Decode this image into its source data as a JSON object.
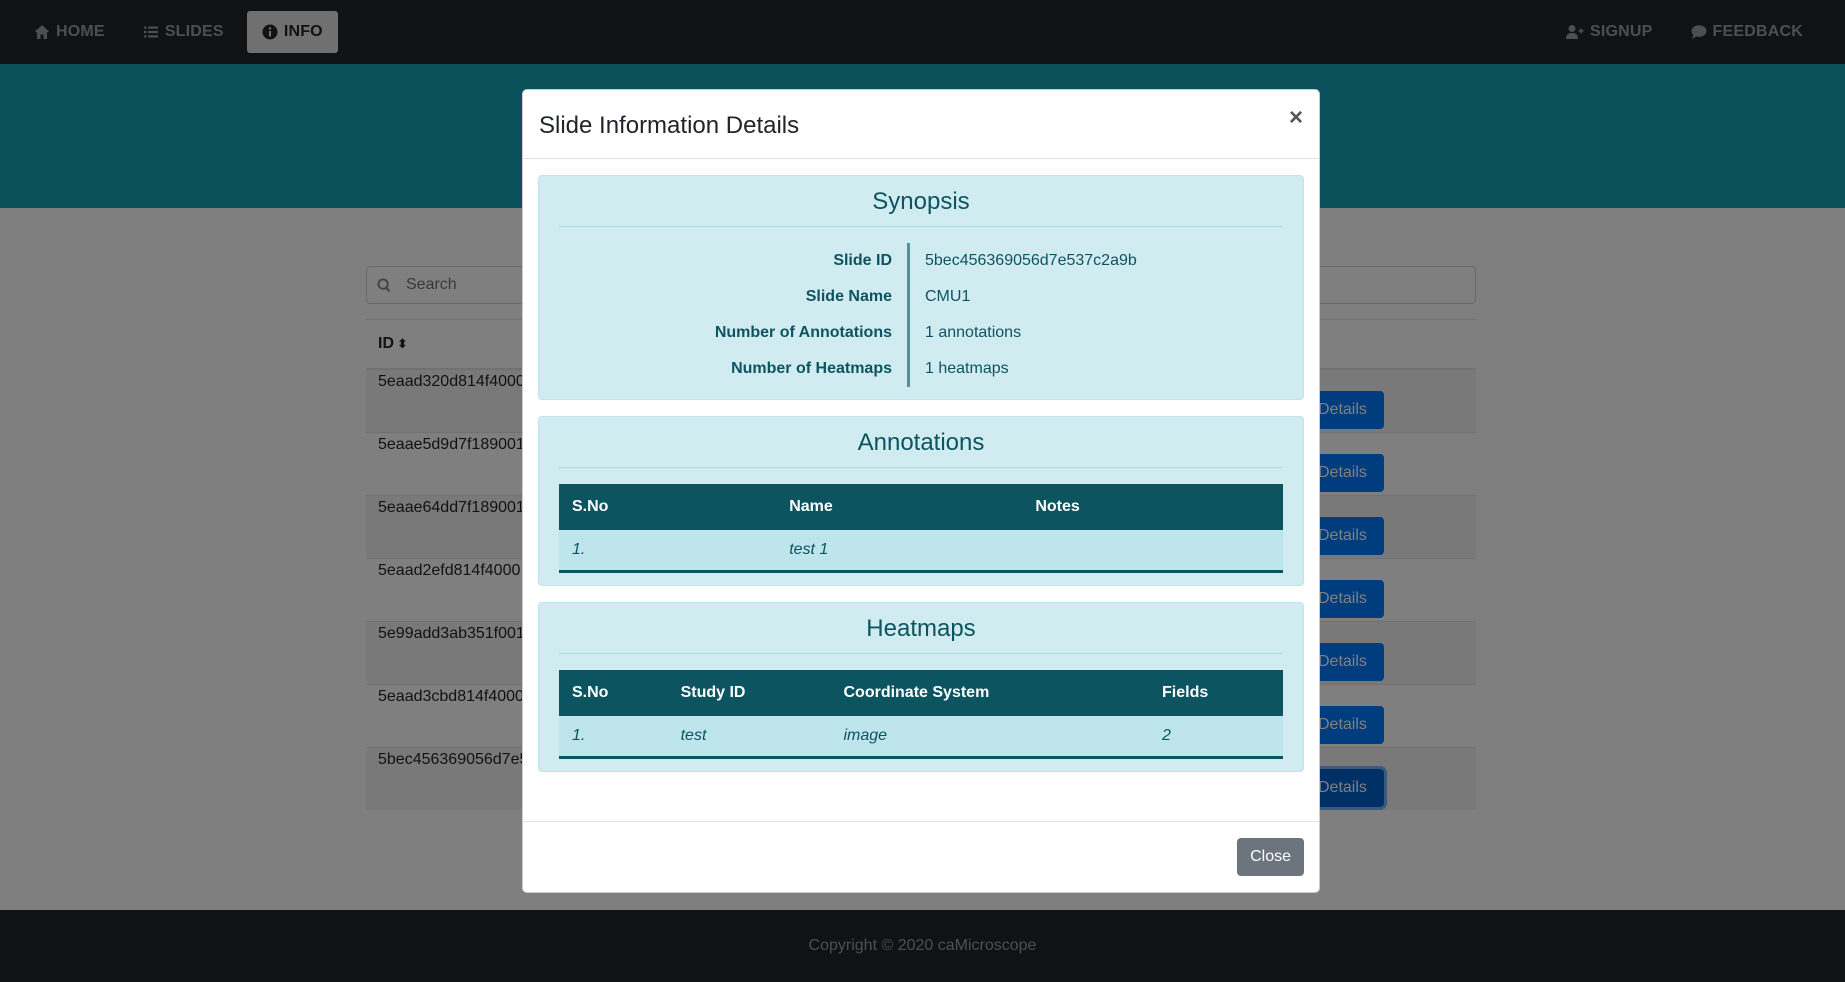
{
  "nav": {
    "left": [
      {
        "label": "HOME",
        "icon": "home-icon",
        "active": false
      },
      {
        "label": "SLIDES",
        "icon": "list-icon",
        "active": false
      },
      {
        "label": "INFO",
        "icon": "info-icon",
        "active": true
      }
    ],
    "right": [
      {
        "label": "SIGNUP",
        "icon": "user-plus-icon"
      },
      {
        "label": "FEEDBACK",
        "icon": "comment-icon"
      }
    ]
  },
  "search": {
    "placeholder": "Search"
  },
  "table": {
    "header_id": "ID",
    "rows": [
      {
        "id": "5eaad320d814f4000",
        "button": "Details"
      },
      {
        "id": "5eaae5d9d7f189001",
        "button": "Details"
      },
      {
        "id": "5eaae64dd7f189001",
        "button": "Details"
      },
      {
        "id": "5eaad2efd814f4000",
        "button": "Details"
      },
      {
        "id": "5e99add3ab351f001",
        "button": "Details"
      },
      {
        "id": "5eaad3cbd814f4000",
        "button": "Details"
      },
      {
        "id": "5bec456369056d7e5",
        "button": "Details"
      }
    ]
  },
  "footer": {
    "text": "Copyright © 2020 caMicroscope"
  },
  "modal": {
    "title": "Slide Information Details",
    "close_x": "×",
    "close_button": "Close",
    "synopsis": {
      "title": "Synopsis",
      "labels": [
        "Slide ID",
        "Slide Name",
        "Number of Annotations",
        "Number of Heatmaps"
      ],
      "values": [
        "5bec456369056d7e537c2a9b",
        "CMU1",
        "1 annotations",
        "1 heatmaps"
      ]
    },
    "annotations": {
      "title": "Annotations",
      "headers": [
        "S.No",
        "Name",
        "Notes"
      ],
      "rows": [
        [
          "1.",
          "test 1",
          ""
        ]
      ]
    },
    "heatmaps": {
      "title": "Heatmaps",
      "headers": [
        "S.No",
        "Study ID",
        "Coordinate System",
        "Fields"
      ],
      "rows": [
        [
          "1.",
          "test",
          "image",
          "2"
        ]
      ]
    }
  },
  "colors": {
    "navbar": "#212529",
    "banner": "#17a2b8",
    "card_bg": "#d1ecf1",
    "table_header": "#0c5460",
    "primary_button": "#007bff",
    "secondary_button": "#6c757d"
  }
}
